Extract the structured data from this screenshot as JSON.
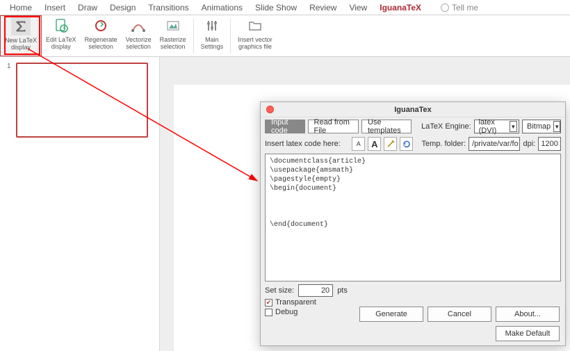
{
  "ribbon": {
    "tabs": [
      "Home",
      "Insert",
      "Draw",
      "Design",
      "Transitions",
      "Animations",
      "Slide Show",
      "Review",
      "View",
      "IguanaTeX"
    ],
    "active_tab": "IguanaTeX",
    "tell_me": "Tell me",
    "buttons": {
      "new_latex": "New LaTeX\ndisplay",
      "edit_latex": "Edit LaTeX\ndisplay",
      "regenerate": "Regenerate\nselection",
      "vectorize": "Vectorize\nselection",
      "rasterize": "Rasterize\nselection",
      "main_settings": "Main\nSettings",
      "insert_vector": "Insert vector\ngraphics file"
    }
  },
  "slides": {
    "num1": "1"
  },
  "dialog": {
    "title": "IguanaTex",
    "tabs": {
      "input_code": "Input code",
      "read_file": "Read from File",
      "use_templates": "Use templates"
    },
    "engine_label": "LaTeX Engine:",
    "engine_value": "latex (DVI)",
    "bitmap": "Bitmap",
    "insert_label": "Insert latex code here:",
    "font_small": "A",
    "font_large": "A",
    "temp_folder_label": "Temp. folder:",
    "temp_folder_value": "/private/var/fo",
    "dpi_label": "dpi:",
    "dpi_value": "1200",
    "code": "\\documentclass{article}\n\\usepackage{amsmath}\n\\pagestyle{empty}\n\\begin{document}\n\n\n\n\\end{document}",
    "set_size_label": "Set size:",
    "set_size_value": "20",
    "pts": "pts",
    "transparent": "Transparent",
    "debug": "Debug",
    "btn_generate": "Generate",
    "btn_cancel": "Cancel",
    "btn_about": "About...",
    "btn_default": "Make Default"
  }
}
